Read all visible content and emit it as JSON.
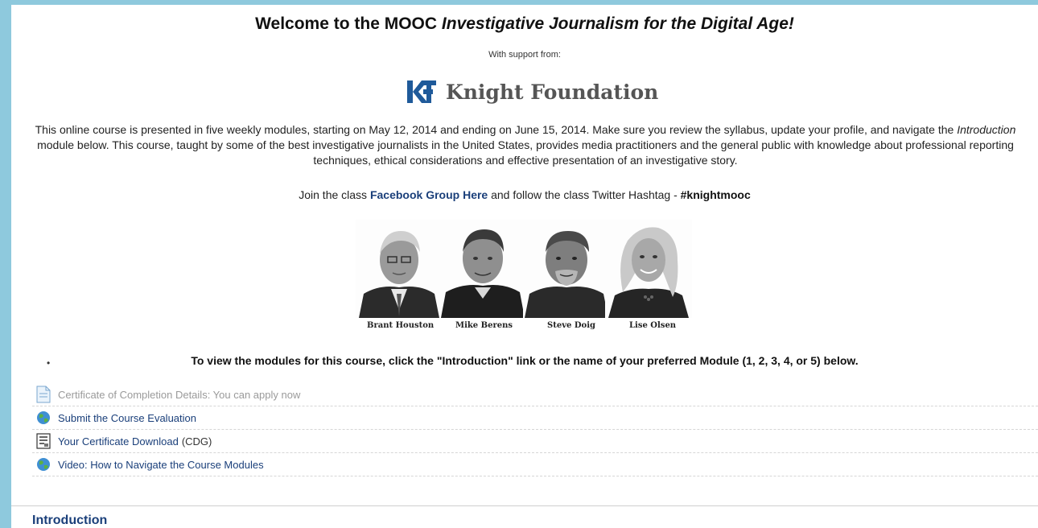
{
  "header": {
    "title_prefix": "Welcome to the MOOC ",
    "title_em": "Investigative Journalism for the Digital Age!",
    "support_text": "With support from:"
  },
  "logo": {
    "mark": "KF",
    "name": "Knight Foundation"
  },
  "intro": {
    "part1": "This online course is presented in five weekly modules, starting on May 12, 2014 and ending on June 15, 2014. Make sure you review the syllabus, update your profile, and navigate the ",
    "em": "Introduction",
    "part2": " module below. This course, taught by some of the best investigative journalists in the United States, provides media practitioners and the general public with knowledge about professional reporting techniques, ethical considerations and effective presentation of an investigative story."
  },
  "join": {
    "prefix": "Join the class ",
    "facebook_link": "Facebook Group Here",
    "middle": " and follow the class Twitter Hashtag - ",
    "hashtag": "#knightmooc"
  },
  "instructors": [
    {
      "name": "Brant Houston"
    },
    {
      "name": "Mike Berens"
    },
    {
      "name": "Steve Doig"
    },
    {
      "name": "Lise Olsen"
    }
  ],
  "bullet": "•",
  "instruction": "To view the modules for this course, click the \"Introduction\" link or the name of your preferred Module (1, 2, 3, 4, or 5) below.",
  "resources": [
    {
      "label": "Certificate of Completion Details: You can apply now",
      "icon": "page-icon",
      "suffix": ""
    },
    {
      "label": "Submit the Course Evaluation",
      "icon": "globe-icon",
      "suffix": ""
    },
    {
      "label": "Your Certificate Download",
      "icon": "certificate-icon",
      "suffix": "(CDG)"
    },
    {
      "label": "Video: How to Navigate the Course Modules",
      "icon": "globe-icon",
      "suffix": ""
    }
  ],
  "section": {
    "title": "Introduction"
  },
  "colors": {
    "background": "#8ec9dd",
    "link": "#1a3f7a",
    "logo_blue": "#1f5a9a"
  }
}
